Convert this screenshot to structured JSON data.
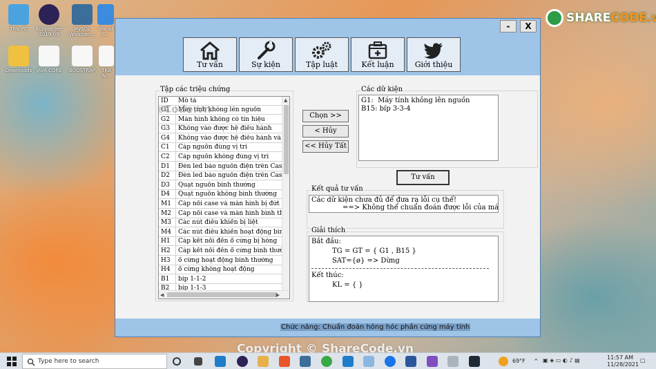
{
  "desktop": {
    "icons": [
      "This PC",
      "Eclipse Jee 2019-09",
      "MySQL Workben...",
      "Visual S...",
      "Downloads",
      "JAVA CORE",
      "BOOSTRAP",
      "TKB N..."
    ],
    "logo_left": "SHARE",
    "logo_right": "CODE.vn",
    "watermark": "Copyright © ShareCode.vn"
  },
  "window": {
    "minimize_label": "-",
    "close_label": "X"
  },
  "toolbar": {
    "items": [
      {
        "label": "Tư vấn",
        "icon": "home-icon"
      },
      {
        "label": "Sự kiện",
        "icon": "wrench-icon"
      },
      {
        "label": "Tập luật",
        "icon": "gears-icon"
      },
      {
        "label": "Kết luận",
        "icon": "medical-case-icon"
      },
      {
        "label": "Giới thiệu",
        "icon": "twitter-bird-icon"
      }
    ]
  },
  "symptoms": {
    "title": "Tập các triệu chứng",
    "watermark": "ShareCode.vn",
    "columns": [
      "ID",
      "Mô tả"
    ],
    "rows": [
      [
        "G1",
        "Máy tính không lên nguồn"
      ],
      [
        "G2",
        "Màn hình không có tín hiệu"
      ],
      [
        "G3",
        "Không vào được hệ điều hành"
      ],
      [
        "G4",
        "Không vào được hệ điều hành và có tiếng"
      ],
      [
        "C1",
        "Cáp nguồn đúng vị trí"
      ],
      [
        "C2",
        "Cáp nguồn không đúng vị trí"
      ],
      [
        "D1",
        "Đèn led báo nguồn điện trên Case máy tính"
      ],
      [
        "D2",
        "Đèn led báo nguồn điện trên Case máy tính"
      ],
      [
        "D3",
        "Quạt nguồn bình thường"
      ],
      [
        "D4",
        "Quạt nguồn không bình thường"
      ],
      [
        "M1",
        "Cáp nối case và màn hình bị đứt"
      ],
      [
        "M2",
        "Cáp nối case và màn hình bình thường"
      ],
      [
        "M3",
        "Các nút điều khiển bị liệt"
      ],
      [
        "M4",
        "Các nút điều khiển hoạt động bình thường"
      ],
      [
        "H1",
        "Cáp kết nối đến ổ cứng bị hỏng"
      ],
      [
        "H2",
        "Cáp kết nối đến ổ cứng bình thường"
      ],
      [
        "H3",
        "ổ cứng hoạt động bình thường"
      ],
      [
        "H4",
        "ổ cứng không hoạt động"
      ],
      [
        "B1",
        "bíp 1-1-2"
      ],
      [
        "B2",
        "bíp 1-1-3"
      ]
    ]
  },
  "actions": {
    "choose": "Chọn >>",
    "cancel": "< Hủy",
    "cancel_all": "<< Hủy Tất"
  },
  "facts": {
    "title": "Các dữ kiện",
    "lines": [
      "G1:  Máy tính không lên nguồn",
      "B15: bíp 3-3-4"
    ]
  },
  "consult_button": "Tư vấn",
  "result": {
    "title": "Kết quả tư vấn",
    "lines": [
      "Các dữ kiện chưa đủ để đưa ra lỗi cụ thể!",
      "==> Không thể chuẩn đoán được lỗi của máy tính!"
    ]
  },
  "explain": {
    "title": "Giải thích",
    "start_label": "Bắt đầu:",
    "start_lines": [
      "TG = GT = { G1 , B15 }",
      "SAT={ø} => Dừng"
    ],
    "end_label": "Kết thúc:",
    "end_lines": [
      "KL = { }"
    ]
  },
  "status": "Chức năng: Chuẩn đoán hỏng hóc phần cứng máy tính",
  "taskbar": {
    "search_placeholder": "Type here to search",
    "weather": "69°F",
    "time": "11:57 AM",
    "date": "11/28/2021"
  }
}
